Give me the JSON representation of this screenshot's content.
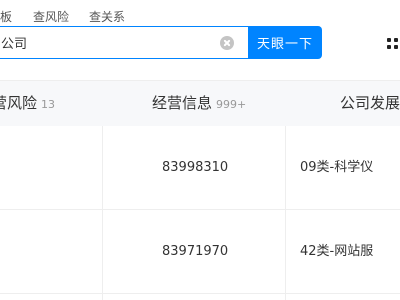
{
  "search": {
    "tabs": [
      "板",
      "查风险",
      "查关系"
    ],
    "value": "公司",
    "button_label": "天眼一下"
  },
  "table": {
    "headers": [
      {
        "label": "营风险",
        "count": "13"
      },
      {
        "label": "经营信息",
        "count": "999+"
      },
      {
        "label": "公司发展",
        "count": ""
      }
    ],
    "rows": [
      {
        "col1": "",
        "col2": "83998310",
        "col3": "09类-科学仪"
      },
      {
        "col1": "",
        "col2": "83971970",
        "col3": "42类-网站服"
      }
    ]
  },
  "colors": {
    "accent": "#0084ff",
    "header_bg": "#f7f8fa",
    "border": "#eeeeee"
  }
}
